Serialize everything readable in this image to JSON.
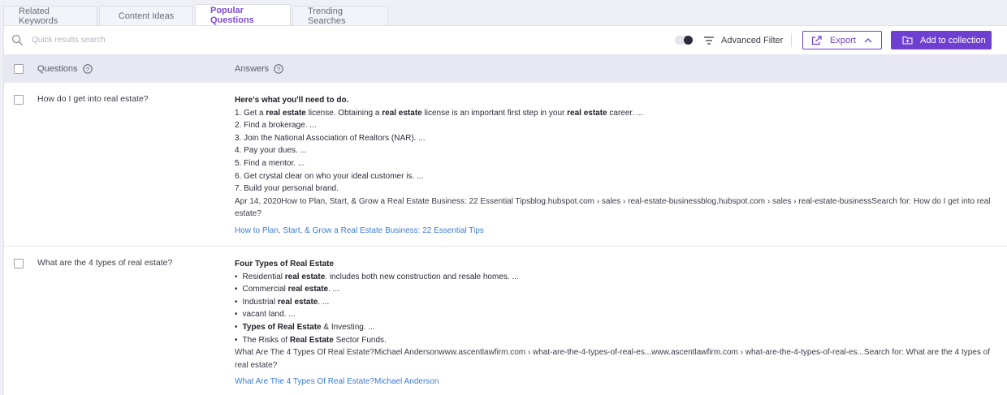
{
  "tabs": [
    {
      "label": "Related Keywords",
      "active": false
    },
    {
      "label": "Content Ideas",
      "active": false
    },
    {
      "label": "Popular Questions",
      "active": true
    },
    {
      "label": "Trending Searches",
      "active": false
    }
  ],
  "toolbar": {
    "search_placeholder": "Quick results search",
    "advanced_filter_label": "Advanced Filter",
    "export_label": "Export",
    "add_collection_label": "Add to collection"
  },
  "table": {
    "col_questions": "Questions",
    "col_answers": "Answers"
  },
  "rows": [
    {
      "question": "How do I get into real estate?",
      "answer_heading": "Here's what you'll need to do.",
      "lines": [
        {
          "parts": [
            {
              "t": "1. Get a "
            },
            {
              "t": "real estate",
              "b": true
            },
            {
              "t": " license. Obtaining a "
            },
            {
              "t": "real estate",
              "b": true
            },
            {
              "t": " license is an important first step in your "
            },
            {
              "t": "real estate",
              "b": true
            },
            {
              "t": " career. ..."
            }
          ]
        },
        {
          "parts": [
            {
              "t": "2. Find a brokerage. ..."
            }
          ]
        },
        {
          "parts": [
            {
              "t": "3. Join the National Association of Realtors (NAR). ..."
            }
          ]
        },
        {
          "parts": [
            {
              "t": "4. Pay your dues. ..."
            }
          ]
        },
        {
          "parts": [
            {
              "t": "5. Find a mentor. ..."
            }
          ]
        },
        {
          "parts": [
            {
              "t": "6. Get crystal clear on who your ideal customer is. ..."
            }
          ]
        },
        {
          "parts": [
            {
              "t": "7. Build your personal brand."
            }
          ]
        }
      ],
      "source": "Apr 14, 2020How to Plan, Start, & Grow a Real Estate Business: 22 Essential Tipsblog.hubspot.com › sales › real-estate-businessblog.hubspot.com › sales › real-estate-businessSearch for: How do I get into real estate?",
      "link": "How to Plan, Start, & Grow a Real Estate Business: 22 Essential Tips"
    },
    {
      "question": "What are the 4 types of real estate?",
      "answer_heading": "Four Types of Real Estate",
      "bullets": [
        {
          "parts": [
            {
              "t": "Residential "
            },
            {
              "t": "real estate",
              "b": true
            },
            {
              "t": ". includes both new construction and resale homes. ..."
            }
          ]
        },
        {
          "parts": [
            {
              "t": "Commercial "
            },
            {
              "t": "real estate",
              "b": true
            },
            {
              "t": ". ..."
            }
          ]
        },
        {
          "parts": [
            {
              "t": "Industrial "
            },
            {
              "t": "real estate",
              "b": true
            },
            {
              "t": ". ..."
            }
          ]
        },
        {
          "parts": [
            {
              "t": "vacant land. ..."
            }
          ]
        },
        {
          "parts": [
            {
              "t": "Types of Real Estate",
              "b": true
            },
            {
              "t": " & Investing. ..."
            }
          ]
        },
        {
          "parts": [
            {
              "t": "The Risks of "
            },
            {
              "t": "Real Estate",
              "b": true
            },
            {
              "t": " Sector Funds."
            }
          ]
        }
      ],
      "source": "What Are The 4 Types Of Real Estate?Michael Andersonwww.ascentlawfirm.com › what-are-the-4-types-of-real-es...www.ascentlawfirm.com › what-are-the-4-types-of-real-es...Search for: What are the 4 types of real estate?",
      "link": "What Are The 4 Types Of Real Estate?Michael Anderson"
    }
  ],
  "colors": {
    "accent": "#6f3fd1",
    "link": "#3d7bd6",
    "header_bg": "#e7e8f2"
  }
}
